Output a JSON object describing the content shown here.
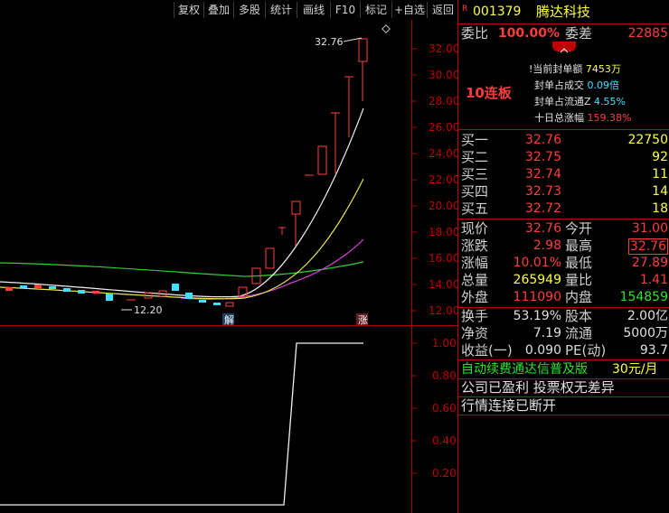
{
  "toolbar": {
    "buttons": [
      "复权",
      "叠加",
      "多股",
      "统计",
      "画线",
      "F10",
      "标记",
      "+自选",
      "返回"
    ]
  },
  "chart": {
    "price_ticks": [
      "32.00",
      "30.00",
      "28.00",
      "26.00",
      "24.00",
      "22.00",
      "20.00",
      "18.00",
      "16.00",
      "14.00",
      "12.00"
    ],
    "high_annotation": "32.76",
    "low_annotation": "12.20",
    "marker_jie": "解",
    "marker_zhang": "涨",
    "sub_ticks": [
      "1.00",
      "0.80",
      "0.60",
      "0.40",
      "0.20"
    ]
  },
  "stock": {
    "badge": "R",
    "code": "001379",
    "name": "腾达科技"
  },
  "weibi": {
    "label": "委比",
    "value": "100.00%",
    "cha_label": "委差",
    "cha_value": "22885"
  },
  "limit": {
    "streak": "10连板",
    "items": [
      {
        "label": "当前封单额",
        "value": "7453万",
        "color": "yellow"
      },
      {
        "label": "封单占成交",
        "value": "0.09倍",
        "color": "cyan"
      },
      {
        "label": "封单占流通Z",
        "value": "4.55%",
        "color": "cyan"
      },
      {
        "label": "十日总涨幅",
        "value": "159.38%",
        "color": "red"
      }
    ]
  },
  "bids": [
    {
      "label": "买一",
      "price": "32.76",
      "vol": "22750"
    },
    {
      "label": "买二",
      "price": "32.75",
      "vol": "92"
    },
    {
      "label": "买三",
      "price": "32.74",
      "vol": "11"
    },
    {
      "label": "买四",
      "price": "32.73",
      "vol": "14"
    },
    {
      "label": "买五",
      "price": "32.72",
      "vol": "18"
    }
  ],
  "quote": {
    "xianjia_label": "现价",
    "xianjia": "32.76",
    "jinkai_label": "今开",
    "jinkai": "31.00",
    "zhangdie_label": "涨跌",
    "zhangdie": "2.98",
    "zuigao_label": "最高",
    "zuigao": "32.76",
    "zhangfu_label": "涨幅",
    "zhangfu": "10.01%",
    "zuidi_label": "最低",
    "zuidi": "27.89",
    "zongliang_label": "总量",
    "zongliang": "265949",
    "liangbi_label": "量比",
    "liangbi": "1.41",
    "waipan_label": "外盘",
    "waipan": "111090",
    "neipan_label": "内盘",
    "neipan": "154859"
  },
  "fundamentals": {
    "huanshou_label": "换手",
    "huanshou": "53.19%",
    "guben_label": "股本",
    "guben": "2.00亿",
    "jingzi_label": "净资",
    "jingzi": "7.19",
    "liutong_label": "流通",
    "liutong": "5000万",
    "shouyi_label": "收益(一)",
    "shouyi": "0.090",
    "pe_label": "PE(动)",
    "pe": "93.7"
  },
  "footer": {
    "promo": "自动续费通达信普及版",
    "price": "30元/月",
    "line1": "公司已盈利 投票权无差异",
    "line2": "行情连接已断开"
  }
}
